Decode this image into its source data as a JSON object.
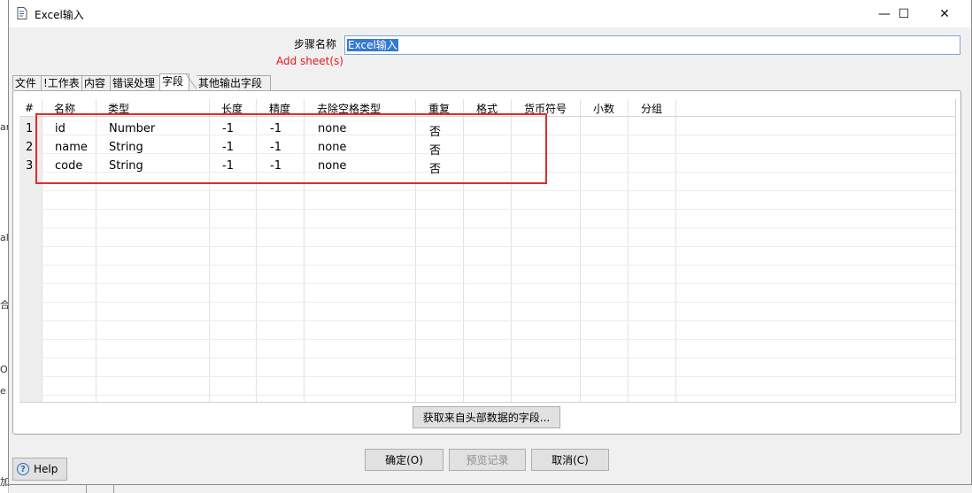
{
  "background": {
    "fragments": [
      "ar",
      "al",
      "合",
      "O",
      "e",
      "加"
    ]
  },
  "window": {
    "title": "Excel输入",
    "controls": {
      "minimize": "—",
      "maximize": "☐",
      "close": "✕"
    }
  },
  "step": {
    "label": "步骤名称",
    "value": "Excel输入",
    "add_sheet": "Add sheet(s)"
  },
  "tabs": [
    {
      "label": "文件",
      "active": false
    },
    {
      "label": "!工作表",
      "active": false
    },
    {
      "label": "内容",
      "active": false
    },
    {
      "label": "错误处理",
      "active": false
    },
    {
      "label": "字段",
      "active": true
    },
    {
      "label": "其他输出字段",
      "active": false
    }
  ],
  "table": {
    "columns": [
      "#",
      "名称",
      "类型",
      "长度",
      "精度",
      "去除空格类型",
      "重复",
      "格式",
      "货币符号",
      "小数",
      "分组"
    ],
    "rows": [
      [
        "1",
        "id",
        "Number",
        "-1",
        "-1",
        "none",
        "否",
        "",
        "",
        "",
        ""
      ],
      [
        "2",
        "name",
        "String",
        "-1",
        "-1",
        "none",
        "否",
        "",
        "",
        "",
        ""
      ],
      [
        "3",
        "code",
        "String",
        "-1",
        "-1",
        "none",
        "否",
        "",
        "",
        "",
        ""
      ]
    ]
  },
  "buttons": {
    "get_fields": "获取来自头部数据的字段...",
    "ok": "确定(O)",
    "preview": "预览记录",
    "cancel": "取消(C)",
    "help": "Help"
  },
  "colors": {
    "highlight": "#e02b2b",
    "add_sheet": "#e8161b",
    "selection": "#3478d0"
  }
}
